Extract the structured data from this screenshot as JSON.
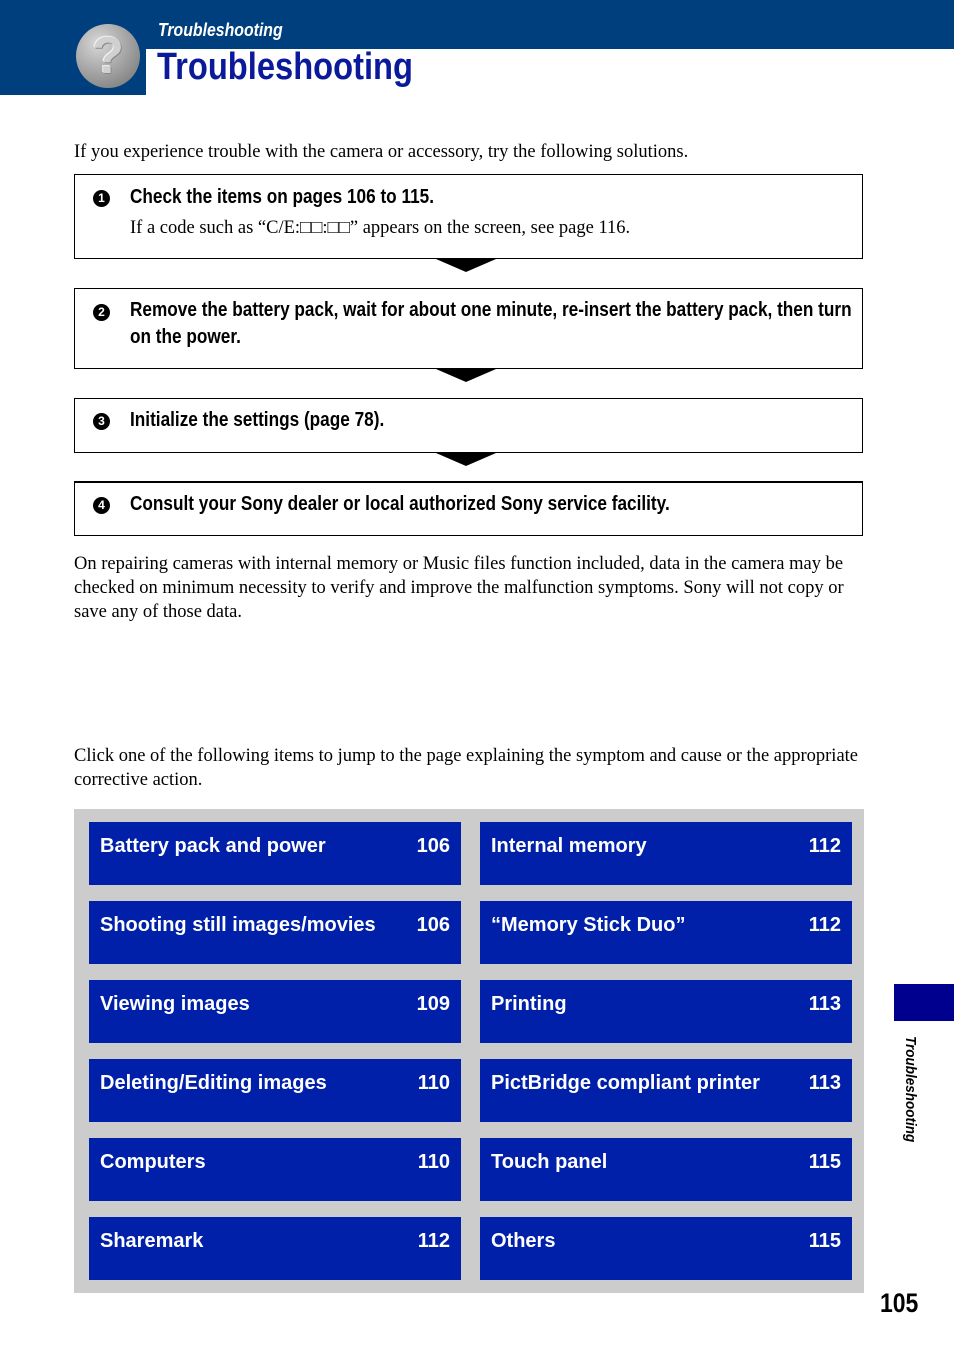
{
  "header": {
    "section_label": "Troubleshooting",
    "title": "Troubleshooting",
    "icon": "question-mark-icon",
    "colors": {
      "band": "#003f7d",
      "title": "#0a1a9a"
    }
  },
  "intro": "If you experience trouble with the camera or accessory, try the following solutions.",
  "steps": [
    {
      "number": "1",
      "text": "Check the items on pages 106 to 115.",
      "note": "If a code such as “C/E:□□:□□” appears on the screen, see page 116."
    },
    {
      "number": "2",
      "text": "Remove the battery pack, wait for about one minute, re-insert the battery pack, then turn on the power."
    },
    {
      "number": "3",
      "text": "Initialize the settings (page 78)."
    },
    {
      "number": "4",
      "text": "Consult your Sony dealer or local authorized Sony service facility."
    }
  ],
  "repair_note": "On repairing cameras with internal memory or Music files function included, data in the camera may be checked on minimum necessity to verify and improve the malfunction symptoms. Sony will not copy or save any of those data.",
  "links_intro": "Click one of the following items to jump to the page explaining the symptom and cause or the appropriate corrective action.",
  "links": {
    "left": [
      {
        "label": "Battery pack and power",
        "page": "106"
      },
      {
        "label": "Shooting still images/movies",
        "page": "106"
      },
      {
        "label": "Viewing images",
        "page": "109"
      },
      {
        "label": "Deleting/Editing images",
        "page": "110"
      },
      {
        "label": "Computers",
        "page": "110"
      },
      {
        "label": "Sharemark",
        "page": "112"
      }
    ],
    "right": [
      {
        "label": "Internal memory",
        "page": "112"
      },
      {
        "label": "“Memory Stick Duo”",
        "page": "112"
      },
      {
        "label": "Printing",
        "page": "113"
      },
      {
        "label": "PictBridge compliant printer",
        "page": "113"
      },
      {
        "label": "Touch panel",
        "page": "115"
      },
      {
        "label": "Others",
        "page": "115"
      }
    ],
    "colors": {
      "button": "#0020aa",
      "panel": "#cccccc"
    }
  },
  "side_tab": {
    "label": "Troubleshooting",
    "color": "#00008f"
  },
  "page_number": "105"
}
